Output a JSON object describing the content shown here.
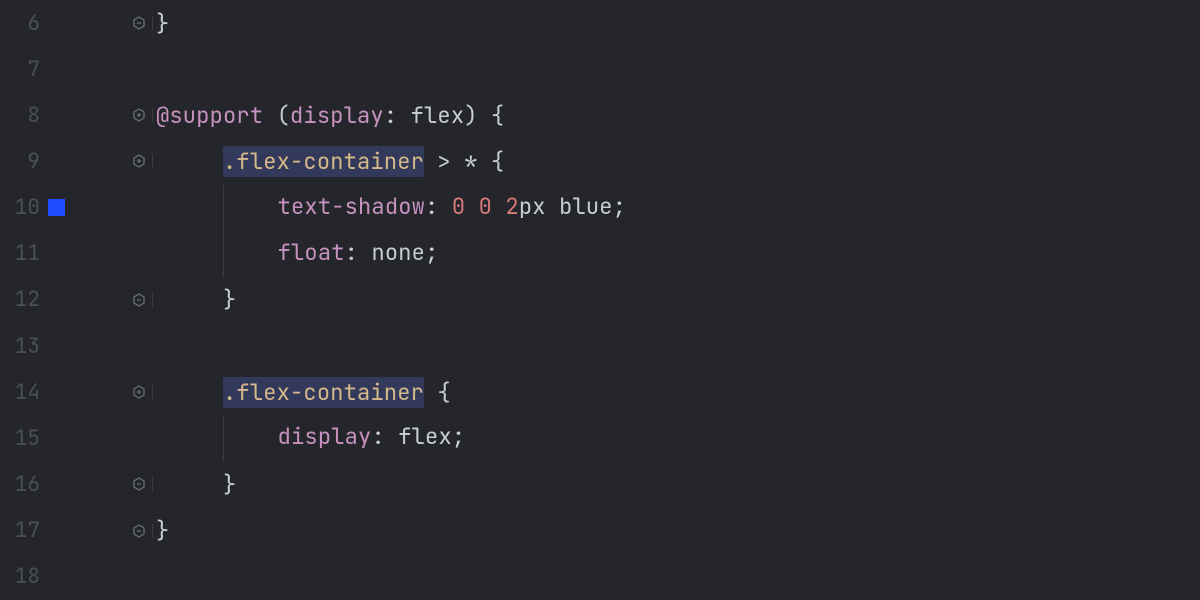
{
  "lines": {
    "6": {
      "num": "6"
    },
    "7": {
      "num": "7"
    },
    "8": {
      "num": "8",
      "at": "@support",
      "paren_open": "(",
      "disp_prop": "display",
      "colon": ":",
      "flex_val": " flex",
      "paren_close": ")",
      "brace": " {"
    },
    "9": {
      "num": "9",
      "cls": ".flex-container",
      "rest": " > * {"
    },
    "10": {
      "num": "10",
      "prop": "text-shadow",
      "colon": ":",
      "n0a": " 0",
      "n0b": " 0",
      "n2": " 2",
      "unit": "px",
      "color_val": " blue",
      "semi": ";"
    },
    "11": {
      "num": "11",
      "prop": "float",
      "colon": ":",
      "val": " none",
      "semi": ";"
    },
    "12": {
      "num": "12",
      "brace": "}"
    },
    "13": {
      "num": "13"
    },
    "14": {
      "num": "14",
      "cls": ".flex-container",
      "brace": " {"
    },
    "15": {
      "num": "15",
      "prop": "display",
      "colon": ":",
      "val": " flex",
      "semi": ";"
    },
    "16": {
      "num": "16",
      "brace": "}"
    },
    "17": {
      "num": "17",
      "brace": "}"
    },
    "18": {
      "num": "18"
    }
  }
}
